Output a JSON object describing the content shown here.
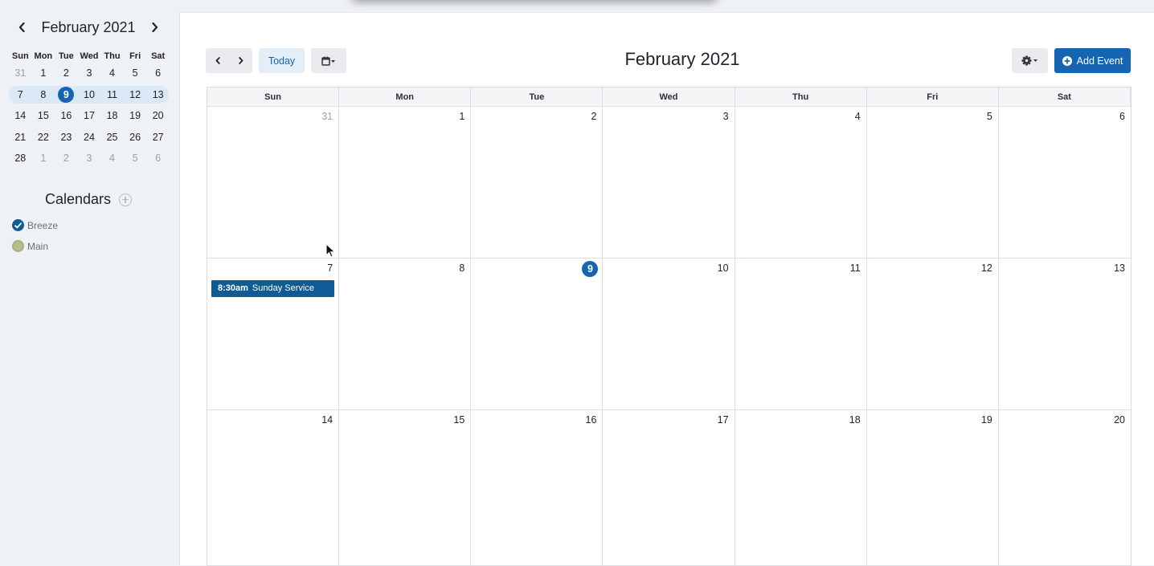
{
  "mini_calendar": {
    "title": "February 2021",
    "prev_icon": "chevron-left-icon",
    "next_icon": "chevron-right-icon",
    "dow": [
      "Sun",
      "Mon",
      "Tue",
      "Wed",
      "Thu",
      "Fri",
      "Sat"
    ],
    "days": [
      {
        "d": "31",
        "muted": true
      },
      {
        "d": "1"
      },
      {
        "d": "2"
      },
      {
        "d": "3"
      },
      {
        "d": "4"
      },
      {
        "d": "5"
      },
      {
        "d": "6"
      },
      {
        "d": "7",
        "week": true
      },
      {
        "d": "8",
        "week": true
      },
      {
        "d": "9",
        "week": true,
        "today": true
      },
      {
        "d": "10",
        "week": true
      },
      {
        "d": "11",
        "week": true
      },
      {
        "d": "12",
        "week": true
      },
      {
        "d": "13",
        "week": true
      },
      {
        "d": "14"
      },
      {
        "d": "15"
      },
      {
        "d": "16"
      },
      {
        "d": "17"
      },
      {
        "d": "18"
      },
      {
        "d": "19"
      },
      {
        "d": "20"
      },
      {
        "d": "21"
      },
      {
        "d": "22"
      },
      {
        "d": "23"
      },
      {
        "d": "24"
      },
      {
        "d": "25"
      },
      {
        "d": "26"
      },
      {
        "d": "27"
      },
      {
        "d": "28"
      },
      {
        "d": "1",
        "muted": true
      },
      {
        "d": "2",
        "muted": true
      },
      {
        "d": "3",
        "muted": true
      },
      {
        "d": "4",
        "muted": true
      },
      {
        "d": "5",
        "muted": true
      },
      {
        "d": "6",
        "muted": true
      }
    ]
  },
  "calendars": {
    "title": "Calendars",
    "add_icon": "plus-circle-icon",
    "items": [
      {
        "label": "Breeze",
        "color": "#0f5b96",
        "checked": true
      },
      {
        "label": "Main",
        "color": "#b7c08a",
        "checked": false
      }
    ]
  },
  "toolbar": {
    "today_label": "Today",
    "title": "February 2021",
    "add_event_label": "Add Event",
    "view_icon": "calendar-icon",
    "settings_icon": "gear-icon"
  },
  "month": {
    "dow": [
      "Sun",
      "Mon",
      "Tue",
      "Wed",
      "Thu",
      "Fri",
      "Sat"
    ],
    "weeks": [
      [
        {
          "d": "31",
          "muted": true
        },
        {
          "d": "1"
        },
        {
          "d": "2"
        },
        {
          "d": "3"
        },
        {
          "d": "4"
        },
        {
          "d": "5"
        },
        {
          "d": "6"
        }
      ],
      [
        {
          "d": "7",
          "events": [
            {
              "time": "8:30am",
              "title": "Sunday Service"
            }
          ]
        },
        {
          "d": "8"
        },
        {
          "d": "9",
          "today": true
        },
        {
          "d": "10"
        },
        {
          "d": "11"
        },
        {
          "d": "12"
        },
        {
          "d": "13"
        }
      ],
      [
        {
          "d": "14"
        },
        {
          "d": "15"
        },
        {
          "d": "16"
        },
        {
          "d": "17"
        },
        {
          "d": "18"
        },
        {
          "d": "19"
        },
        {
          "d": "20"
        }
      ]
    ]
  },
  "colors": {
    "accent": "#1565b3",
    "event": "#0f5b96",
    "week_highlight": "#dbe9f7"
  }
}
